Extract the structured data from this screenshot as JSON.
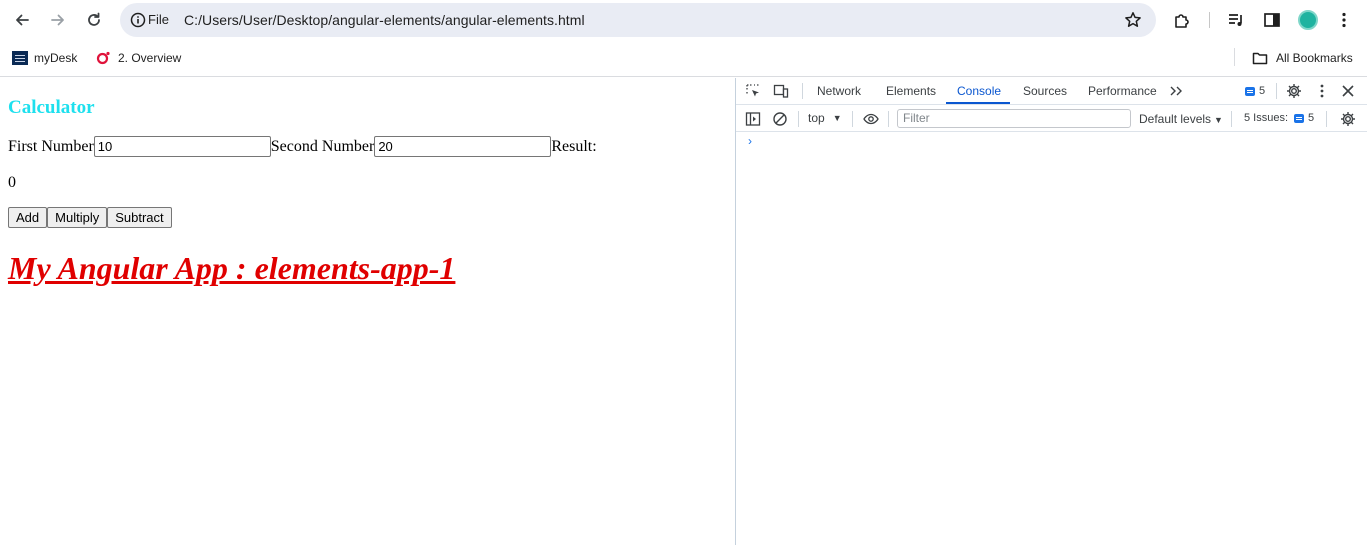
{
  "browser": {
    "omnibox": {
      "scheme_label": "File",
      "url": "C:/Users/User/Desktop/angular-elements/angular-elements.html"
    },
    "bookmarks": [
      {
        "label": "myDesk",
        "icon": "morgan-stanley-favicon"
      },
      {
        "label": "2. Overview",
        "icon": "opera-o-favicon"
      }
    ],
    "all_bookmarks_label": "All Bookmarks",
    "colors": {
      "omnibox_bg": "#e9ecf4",
      "avatar": "#1fb3a0"
    }
  },
  "page": {
    "calculator": {
      "title": "Calculator",
      "first_label": "First Number",
      "first_value": "10",
      "second_label": "Second Number",
      "second_value": "20",
      "result_label": "Result:",
      "result_value": "0",
      "buttons": {
        "add": "Add",
        "multiply": "Multiply",
        "subtract": "Subtract"
      }
    },
    "app_heading": "My Angular App : elements-app-1",
    "colors": {
      "title": "#1ee0ee",
      "heading": "#e00000"
    }
  },
  "devtools": {
    "tabs": [
      {
        "label": "Network",
        "active": false
      },
      {
        "label": "Elements",
        "active": false
      },
      {
        "label": "Console",
        "active": true
      },
      {
        "label": "Sources",
        "active": false
      },
      {
        "label": "Performance",
        "active": false
      }
    ],
    "issues_badge": "5",
    "context": "top",
    "filter_placeholder": "Filter",
    "levels_label": "Default levels",
    "issues_label": "5 Issues:",
    "issues_count": "5",
    "prompt_glyph": "›",
    "colors": {
      "accent": "#0b57d0"
    }
  }
}
